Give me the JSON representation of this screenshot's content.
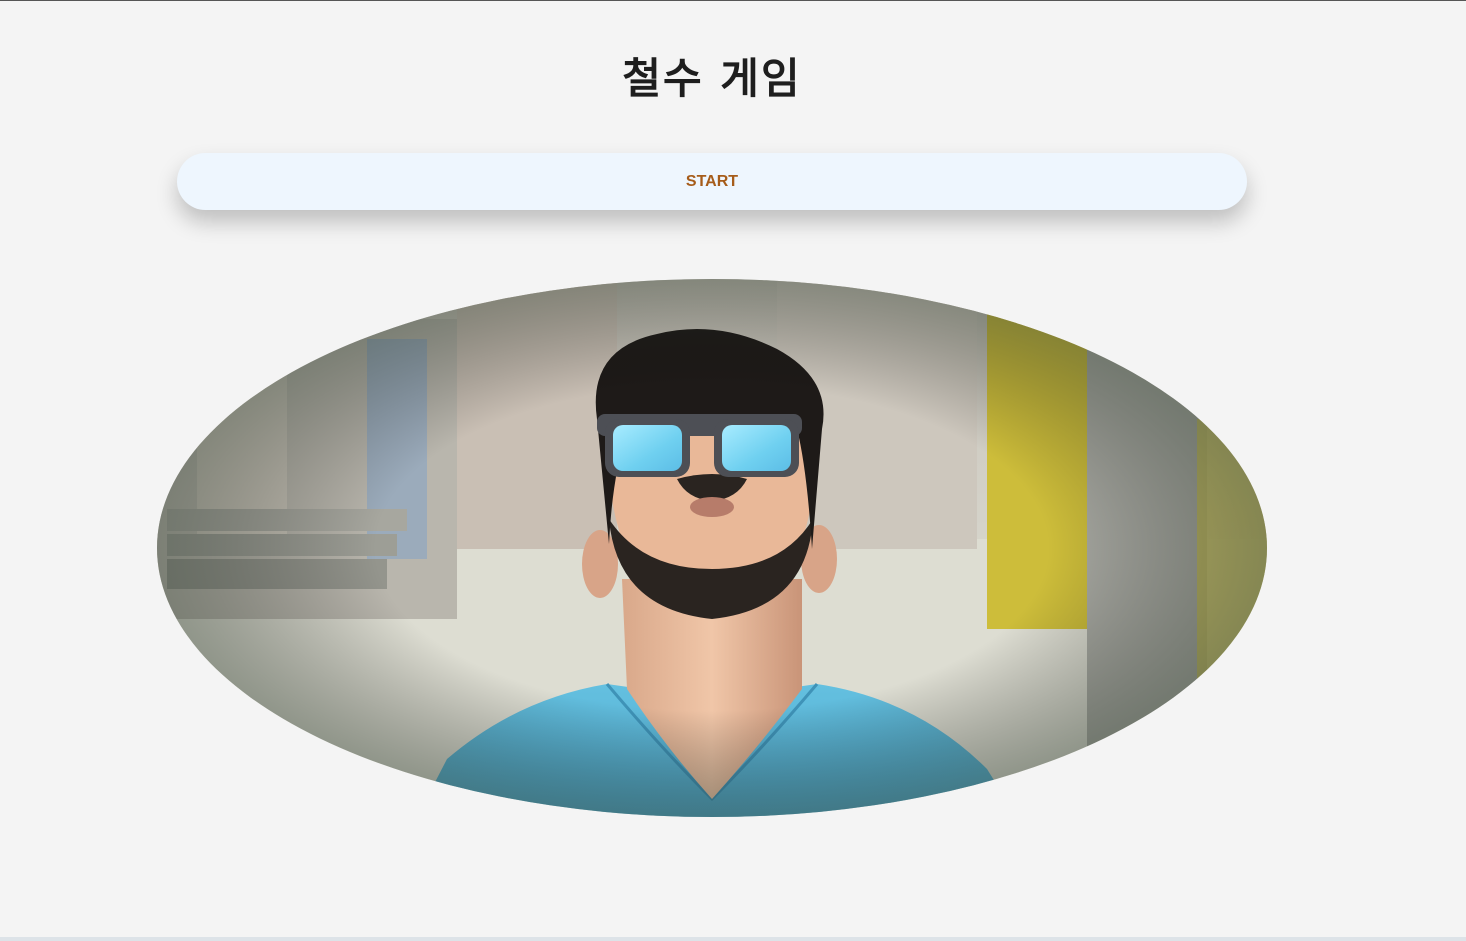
{
  "header": {
    "title": "철수 게임"
  },
  "controls": {
    "start_label": "START"
  },
  "image": {
    "subject": "man-looking-up-sunglasses",
    "shape": "ellipse"
  },
  "colors": {
    "background": "#f4f4f4",
    "title": "#1e1e1e",
    "button_bg": "#eef6fe",
    "button_text": "#a65c1a",
    "shirt": "#5bb6d8",
    "lens": "#7fd8f4"
  }
}
